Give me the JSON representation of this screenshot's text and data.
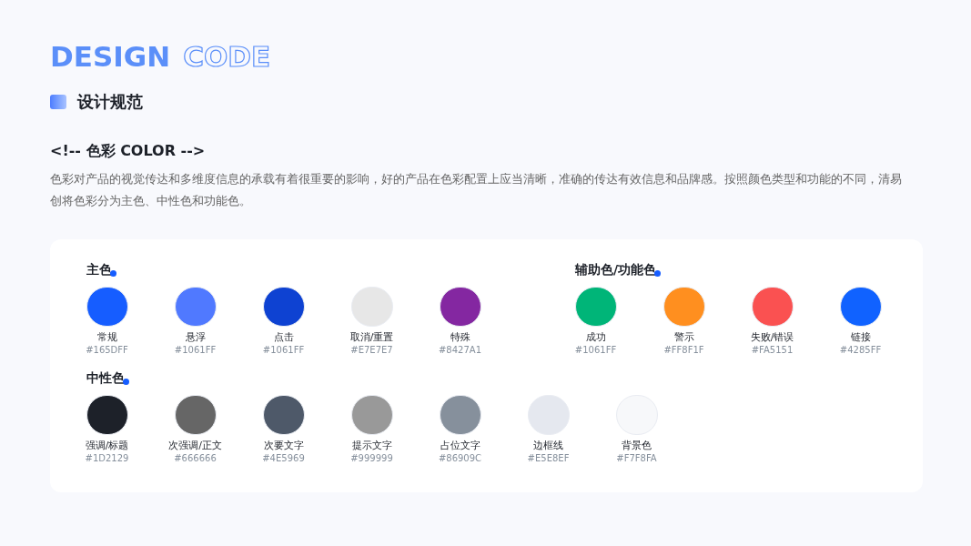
{
  "header": {
    "title_bold": "DESIGN",
    "title_outline": "CODE",
    "subtitle": "设计规范"
  },
  "section": {
    "heading": "<!-- 色彩 COLOR -->",
    "description": "色彩对产品的视觉传达和多维度信息的承载有着很重要的影响，好的产品在色彩配置上应当清晰，准确的传达有效信息和品牌感。按照颜色类型和功能的不同，清易创将色彩分为主色、中性色和功能色。"
  },
  "palettes": [
    {
      "title": "主色",
      "swatches": [
        {
          "name": "常规",
          "hex": "#165DFF",
          "color": "#165dff"
        },
        {
          "name": "悬浮",
          "hex": "#1061FF",
          "color": "#5079ff"
        },
        {
          "name": "点击",
          "hex": "#1061FF",
          "color": "#0e42d2"
        },
        {
          "name": "取消/重置",
          "hex": "#E7E7E7",
          "color": "#e7e7e7"
        },
        {
          "name": "特殊",
          "hex": "#8427A1",
          "color": "#8427a1"
        }
      ]
    },
    {
      "title": "辅助色/功能色",
      "swatches": [
        {
          "name": "成功",
          "hex": "#1061FF",
          "color": "#00b578"
        },
        {
          "name": "警示",
          "hex": "#FF8F1F",
          "color": "#ff8f1f"
        },
        {
          "name": "失败/错误",
          "hex": "#FA5151",
          "color": "#fa5151"
        },
        {
          "name": "链接",
          "hex": "#4285FF",
          "color": "#1062ff"
        }
      ]
    },
    {
      "title": "中性色",
      "swatches": [
        {
          "name": "强调/标题",
          "hex": "#1D2129",
          "color": "#1d2129"
        },
        {
          "name": "次强调/正文",
          "hex": "#666666",
          "color": "#666666"
        },
        {
          "name": "次要文字",
          "hex": "#4E5969",
          "color": "#4e5969"
        },
        {
          "name": "提示文字",
          "hex": "#999999",
          "color": "#999999"
        },
        {
          "name": "占位文字",
          "hex": "#86909C",
          "color": "#86909c"
        },
        {
          "name": "边框线",
          "hex": "#E5E8EF",
          "color": "#e5e8ef"
        },
        {
          "name": "背景色",
          "hex": "#F7F8FA",
          "color": "#f7f8fa"
        }
      ]
    }
  ]
}
